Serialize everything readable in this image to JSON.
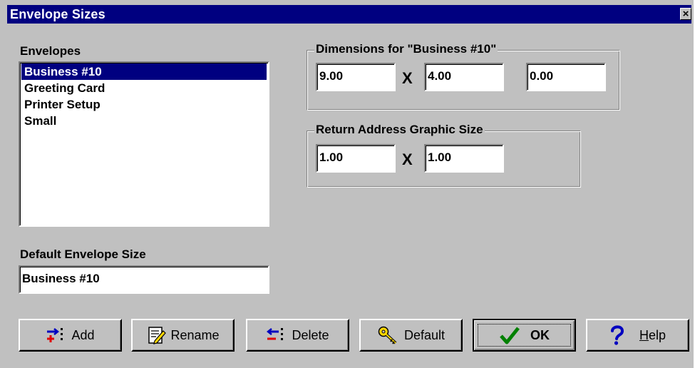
{
  "window": {
    "title": "Envelope Sizes",
    "close_glyph": "×"
  },
  "envelopes": {
    "label": "Envelopes",
    "items": [
      "Business #10",
      "Greeting Card",
      "Printer Setup",
      "Small"
    ],
    "selected_index": 0
  },
  "default_size": {
    "label": "Default Envelope Size",
    "value": "Business #10"
  },
  "dimensions": {
    "legend": "Dimensions for \"Business #10\"",
    "width": "9.00",
    "height": "4.00",
    "third": "0.00",
    "separator": "X"
  },
  "return_address": {
    "legend": "Return Address Graphic Size",
    "width": "1.00",
    "height": "1.00",
    "separator": "X"
  },
  "buttons": {
    "add": {
      "label": "Add",
      "icon": "add-icon"
    },
    "rename": {
      "label": "Rename",
      "icon": "rename-icon"
    },
    "delete": {
      "label": "Delete",
      "icon": "delete-icon"
    },
    "default": {
      "label": "Default",
      "icon": "key-icon"
    },
    "ok": {
      "label": "OK",
      "icon": "checkmark-icon"
    },
    "help": {
      "label": "Help",
      "icon": "question-icon"
    }
  },
  "colors": {
    "titlebar": "#000080",
    "face": "#c0c0c0",
    "selection": "#000080"
  }
}
